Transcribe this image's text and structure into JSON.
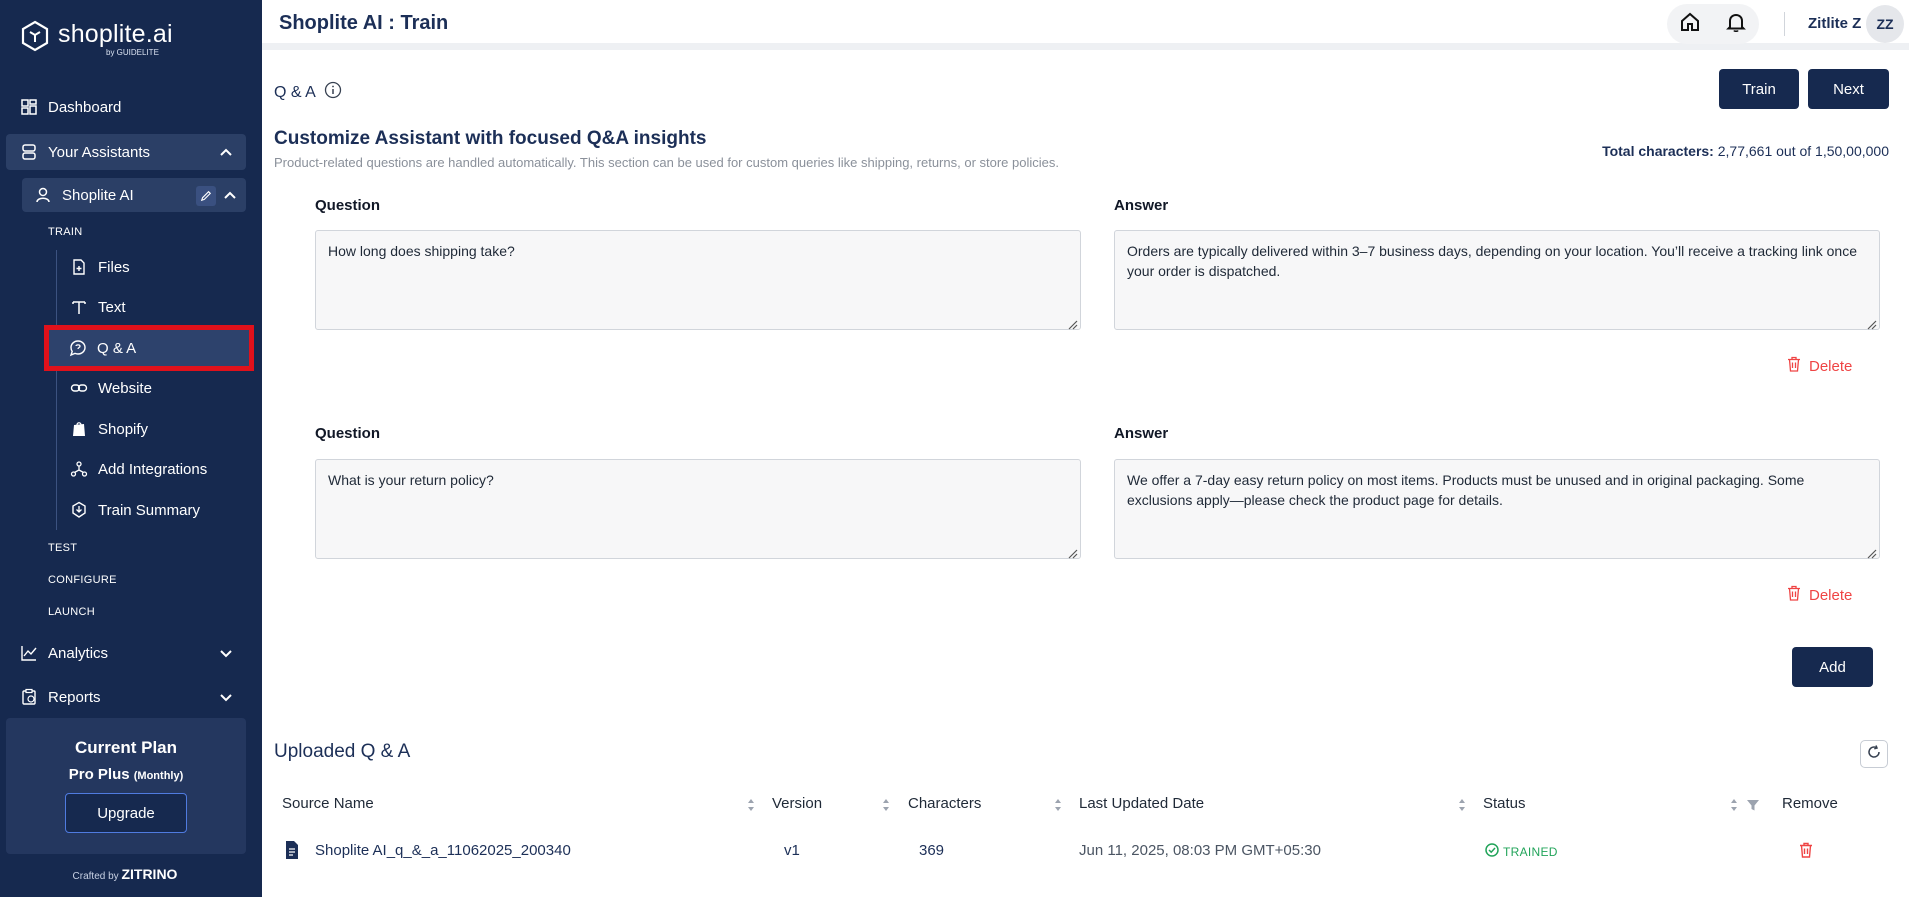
{
  "brand": {
    "name": "shoplite.ai",
    "sub": "by GUIDELITE"
  },
  "sidebar": {
    "dashboard": "Dashboard",
    "your_assistants": "Your Assistants",
    "assistant_name": "Shoplite AI",
    "sections": {
      "train": "TRAIN",
      "test": "TEST",
      "configure": "CONFIGURE",
      "launch": "LAUNCH"
    },
    "train_items": [
      {
        "label": "Files",
        "icon": "file-add-icon"
      },
      {
        "label": "Text",
        "icon": "text-icon"
      },
      {
        "label": "Q & A",
        "icon": "chat-question-icon"
      },
      {
        "label": "Website",
        "icon": "link-icon"
      },
      {
        "label": "Shopify",
        "icon": "shopify-bag-icon"
      },
      {
        "label": "Add Integrations",
        "icon": "integrations-icon"
      },
      {
        "label": "Train Summary",
        "icon": "train-summary-icon"
      }
    ],
    "analytics": "Analytics",
    "reports": "Reports",
    "plan": {
      "title": "Current Plan",
      "name": "Pro Plus",
      "period": "(Monthly)",
      "upgrade": "Upgrade"
    },
    "crafted_by": "Crafted by",
    "crafted_brand": "ZITRINO"
  },
  "header": {
    "title": "Shoplite AI : Train",
    "user_name": "Zitlite Z",
    "initials": "ZZ"
  },
  "main": {
    "section": "Q & A",
    "train_btn": "Train",
    "next_btn": "Next",
    "headline": "Customize Assistant with focused Q&A insights",
    "subline": "Product-related questions are handled automatically. This section can be used for custom queries like shipping, returns, or store policies.",
    "total_label": "Total characters:",
    "total_value": "2,77,661 out of 1,50,00,000",
    "question_label": "Question",
    "answer_label": "Answer",
    "delete_label": "Delete",
    "add_btn": "Add",
    "qa": [
      {
        "question": "How long does shipping take?",
        "answer": "Orders are typically delivered within 3–7 business days, depending on your location. You’ll receive a tracking link once your order is dispatched."
      },
      {
        "question": "What is your return policy?",
        "answer": "We offer a 7-day easy return policy on most items. Products must be unused and in original packaging. Some exclusions apply—please check the product page for details."
      }
    ],
    "uploaded_title": "Uploaded Q & A",
    "table": {
      "headers": [
        "Source Name",
        "Version",
        "Characters",
        "Last Updated Date",
        "Status",
        "Remove"
      ],
      "rows": [
        {
          "source": "Shoplite AI_q_&_a_11062025_200340",
          "version": "v1",
          "characters": "369",
          "updated": "Jun 11, 2025, 08:03 PM GMT+05:30",
          "status": "TRAINED"
        }
      ]
    }
  }
}
